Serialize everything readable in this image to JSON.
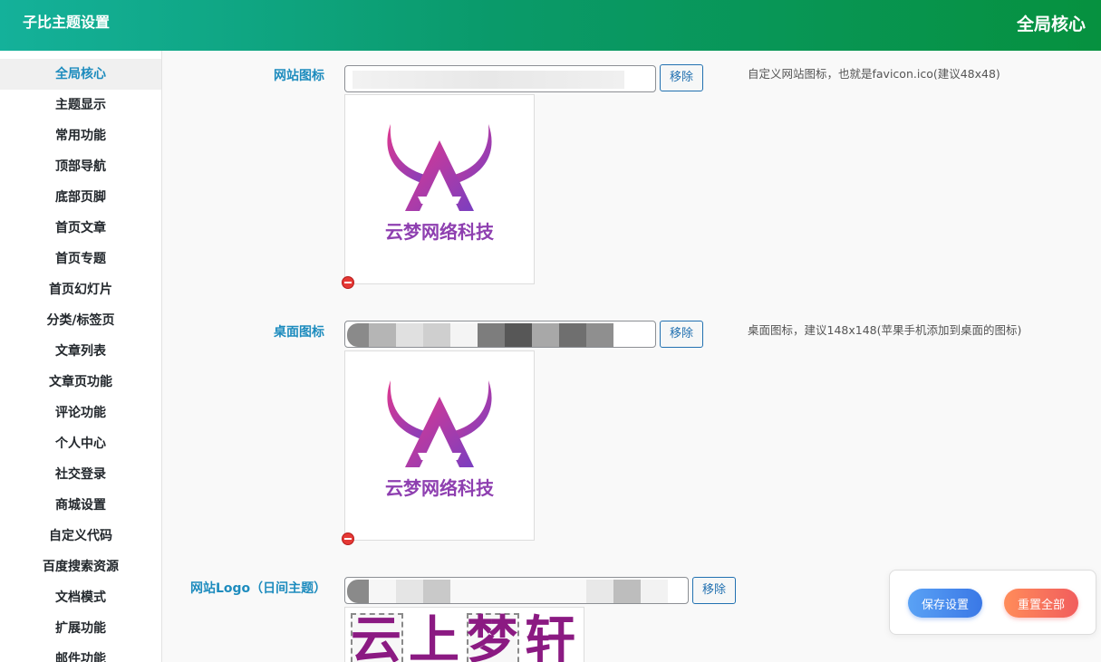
{
  "header": {
    "title": "子比主题设置",
    "section": "全局核心"
  },
  "sidebar": {
    "items": [
      {
        "label": "全局核心",
        "active": true
      },
      {
        "label": "主题显示"
      },
      {
        "label": "常用功能"
      },
      {
        "label": "顶部导航"
      },
      {
        "label": "底部页脚"
      },
      {
        "label": "首页文章"
      },
      {
        "label": "首页专题"
      },
      {
        "label": "首页幻灯片"
      },
      {
        "label": "分类/标签页"
      },
      {
        "label": "文章列表"
      },
      {
        "label": "文章页功能"
      },
      {
        "label": "评论功能"
      },
      {
        "label": "个人中心"
      },
      {
        "label": "社交登录"
      },
      {
        "label": "商城设置"
      },
      {
        "label": "自定义代码"
      },
      {
        "label": "百度搜索资源"
      },
      {
        "label": "文档模式"
      },
      {
        "label": "扩展功能"
      },
      {
        "label": "邮件功能"
      }
    ]
  },
  "fields": {
    "favicon": {
      "label": "网站图标",
      "remove_label": "移除",
      "description": "自定义网站图标，也就是favicon.ico(建议48x48)",
      "preview_text": "云梦网络科技"
    },
    "desktop_icon": {
      "label": "桌面图标",
      "remove_label": "移除",
      "description": "桌面图标，建议148x148(苹果手机添加到桌面的图标)",
      "preview_text": "云梦网络科技"
    },
    "logo_day": {
      "label": "网站Logo（日间主题）",
      "remove_label": "移除",
      "preview_chars": [
        "云",
        "上",
        "梦",
        "轩"
      ]
    }
  },
  "actions": {
    "save_label": "保存设置",
    "reset_label": "重置全部"
  },
  "colors": {
    "accent": "#1e8cbe",
    "header_start": "#14b19a",
    "header_end": "#06913f",
    "logo_purple": "#8b1a82"
  }
}
